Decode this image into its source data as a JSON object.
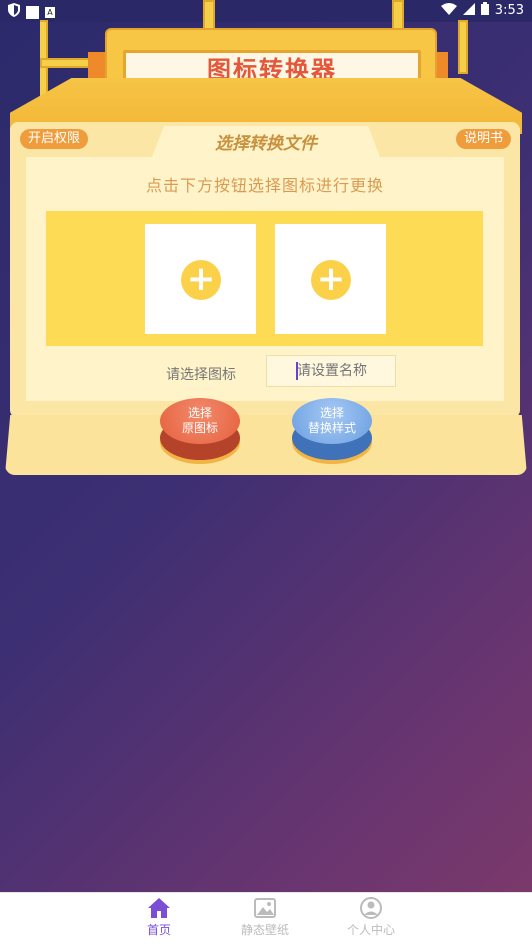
{
  "status_bar": {
    "time": "3:53"
  },
  "sign": {
    "title": "图标转换器"
  },
  "panel": {
    "tab_title": "选择转换文件",
    "left_badge": "开启权限",
    "right_badge": "说明书",
    "instruction": "点击下方按钮选择图标进行更换",
    "select_icon_label": "请选择图标",
    "name_input_placeholder": "请设置名称",
    "slot_plus": "+"
  },
  "buttons": {
    "original": {
      "line1": "选择",
      "line2": "原图标",
      "color": "#e8684a"
    },
    "style": {
      "line1": "选择",
      "line2": "替换样式",
      "color": "#6a9fe0"
    }
  },
  "nav": {
    "items": [
      {
        "label": "首页",
        "icon": "home-icon",
        "active": true
      },
      {
        "label": "静态壁纸",
        "icon": "wallpaper-icon",
        "active": false
      },
      {
        "label": "个人中心",
        "icon": "person-icon",
        "active": false
      }
    ],
    "active_color": "#7a4fd6"
  }
}
